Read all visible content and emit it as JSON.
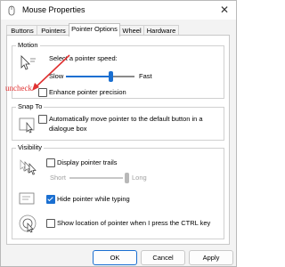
{
  "window": {
    "title": "Mouse Properties",
    "close_glyph": "✕"
  },
  "tabs": [
    {
      "label": "Buttons"
    },
    {
      "label": "Pointers"
    },
    {
      "label": "Pointer Options"
    },
    {
      "label": "Wheel"
    },
    {
      "label": "Hardware"
    }
  ],
  "motion": {
    "group_label": "Motion",
    "speed_label": "Select a pointer speed:",
    "slow_label": "Slow",
    "fast_label": "Fast",
    "speed_level": 0.5,
    "precision_label": "Enhance pointer precision",
    "precision_checked": false
  },
  "snap_to": {
    "group_label": "Snap To",
    "label_line1": "Automatically move pointer to the default button in a",
    "label_line2": "dialogue box",
    "checked": false
  },
  "visibility": {
    "group_label": "Visibility",
    "trails_label": "Display pointer trails",
    "trails_checked": false,
    "short_label": "Short",
    "long_label": "Long",
    "hide_label": "Hide pointer while typing",
    "hide_checked": true,
    "ctrl_label": "Show location of pointer when I press the CTRL key",
    "ctrl_checked": false
  },
  "buttons": {
    "ok": "OK",
    "cancel": "Cancel",
    "apply": "Apply"
  },
  "annotation": {
    "text": "uncheck",
    "color": "#e03232"
  },
  "colors": {
    "accent": "#1a6fd1",
    "annotation": "#e03232"
  }
}
